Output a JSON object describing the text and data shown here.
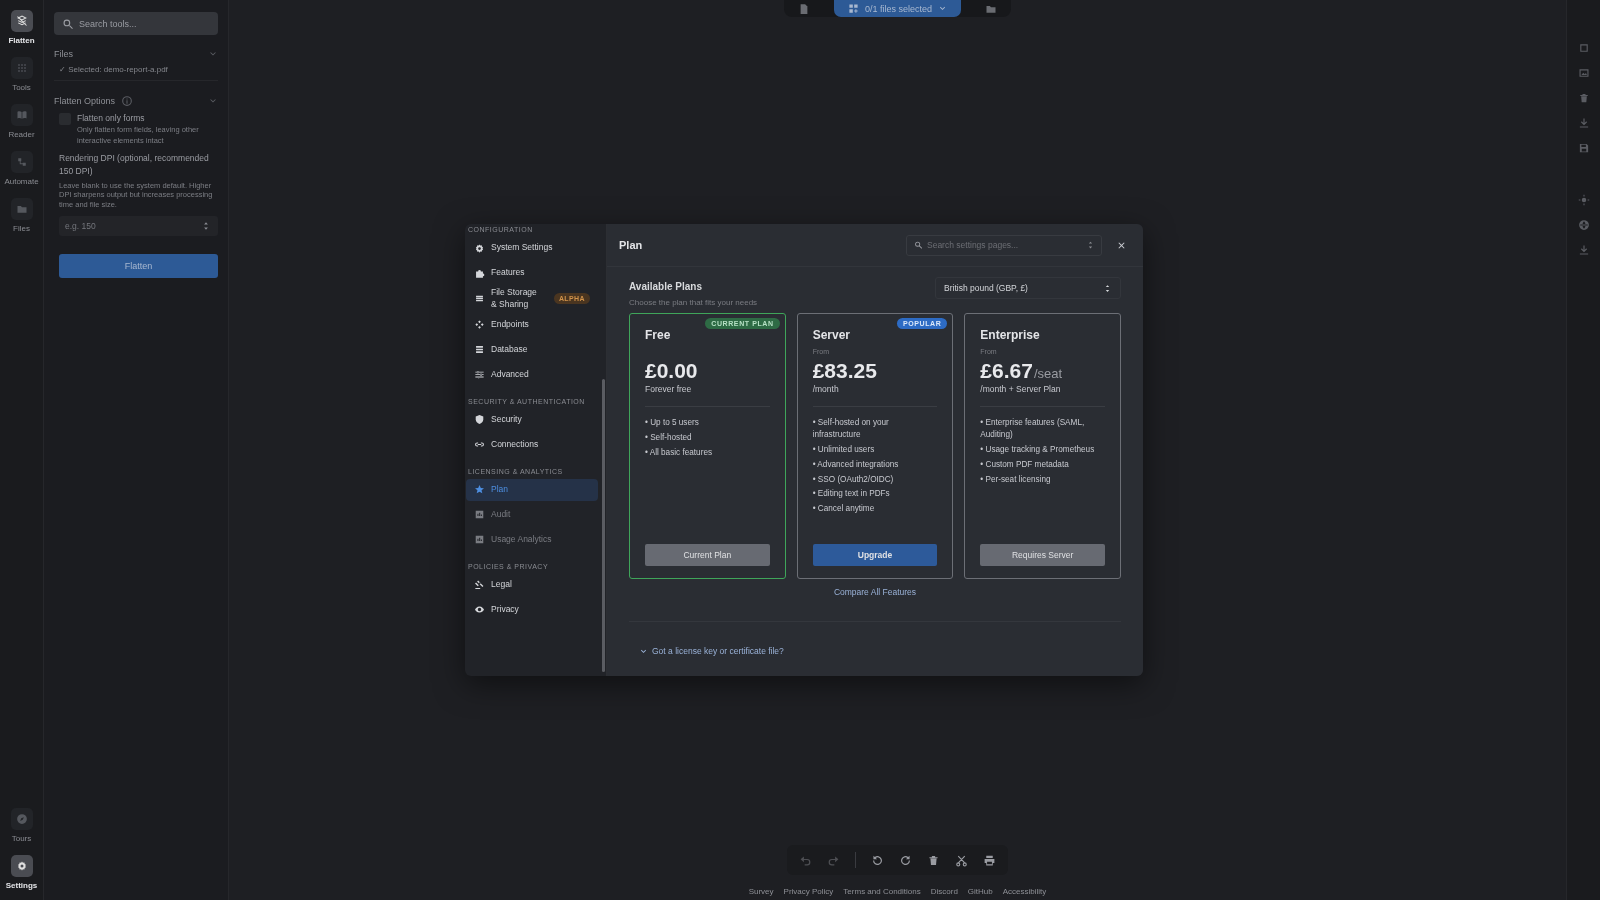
{
  "rail": {
    "items": [
      {
        "label": "Flatten",
        "selected": true
      },
      {
        "label": "Tools",
        "selected": false
      },
      {
        "label": "Reader",
        "selected": false
      },
      {
        "label": "Automate",
        "selected": false
      },
      {
        "label": "Files",
        "selected": false
      }
    ],
    "bottom_items": [
      {
        "label": "Tours",
        "selected": false
      },
      {
        "label": "Settings",
        "selected": true
      }
    ]
  },
  "tool_panel": {
    "search": {
      "placeholder": "Search tools..."
    },
    "files": {
      "title": "Files",
      "selected_file": "✓ Selected: demo-report-a.pdf"
    },
    "options": {
      "title": "Flatten Options",
      "checkbox": {
        "label": "Flatten only forms",
        "description": "Only flatten form fields, leaving other interactive elements intact",
        "checked": false
      },
      "dpi": {
        "label": "Rendering DPI (optional, recommended 150 DPI)",
        "help": "Leave blank to use the system default. Higher DPI sharpens output but increases processing time and file size.",
        "placeholder": "e.g. 150"
      }
    },
    "action_button": "Flatten"
  },
  "file_bar": {
    "label": "0/1 files selected"
  },
  "settings": {
    "sidebar": [
      {
        "heading": "CONFIGURATION",
        "items": [
          {
            "label": "System Settings",
            "selected": false,
            "disabled": false
          },
          {
            "label": "Features",
            "selected": false,
            "disabled": false
          },
          {
            "label": "File Storage & Sharing",
            "selected": false,
            "disabled": false,
            "badge": "ALPHA"
          },
          {
            "label": "Endpoints",
            "selected": false,
            "disabled": false
          },
          {
            "label": "Database",
            "selected": false,
            "disabled": false
          },
          {
            "label": "Advanced",
            "selected": false,
            "disabled": false
          }
        ]
      },
      {
        "heading": "SECURITY & AUTHENTICATION",
        "items": [
          {
            "label": "Security",
            "selected": false,
            "disabled": false
          },
          {
            "label": "Connections",
            "selected": false,
            "disabled": false
          }
        ]
      },
      {
        "heading": "LICENSING & ANALYTICS",
        "items": [
          {
            "label": "Plan",
            "selected": true,
            "disabled": false
          },
          {
            "label": "Audit",
            "selected": false,
            "disabled": true
          },
          {
            "label": "Usage Analytics",
            "selected": false,
            "disabled": true
          }
        ]
      },
      {
        "heading": "POLICIES & PRIVACY",
        "items": [
          {
            "label": "Legal",
            "selected": false,
            "disabled": false
          },
          {
            "label": "Privacy",
            "selected": false,
            "disabled": false
          }
        ]
      }
    ],
    "page_title": "Plan",
    "search": {
      "placeholder": "Search settings pages..."
    },
    "section_title": "Available Plans",
    "section_subtitle": "Choose the plan that fits your needs",
    "currency": {
      "value": "British pound (GBP, £)"
    },
    "plans": [
      {
        "name": "Free",
        "current": true,
        "badge": {
          "label": "CURRENT PLAN",
          "kind": "current"
        },
        "price": "£0.00",
        "period": "Forever free",
        "features": [
          "• Up to 5 users",
          "• Self-hosted",
          "• All basic features"
        ],
        "button": {
          "label": "Current Plan",
          "kind": "secondary"
        }
      },
      {
        "name": "Server",
        "current": false,
        "badge": {
          "label": "POPULAR",
          "kind": "popular"
        },
        "from": "From",
        "price": "£83.25",
        "period": "/month",
        "features": [
          "• Self-hosted on your infrastructure",
          "• Unlimited users",
          "• Advanced integrations",
          "• SSO (OAuth2/OIDC)",
          "• Editing text in PDFs",
          "• Cancel anytime"
        ],
        "button": {
          "label": "Upgrade",
          "kind": "primary"
        }
      },
      {
        "name": "Enterprise",
        "current": false,
        "from": "From",
        "price": "£6.67",
        "unit": "/seat",
        "period": "/month + Server Plan",
        "features": [
          "• Enterprise features (SAML, Auditing)",
          "• Usage tracking & Prometheus",
          "• Custom PDF metadata",
          "• Per-seat licensing"
        ],
        "button": {
          "label": "Requires Server",
          "kind": "secondary"
        }
      }
    ],
    "compare_link": "Compare All Features",
    "license_toggle": "Got a license key or certificate file?"
  },
  "footer_links": [
    "Survey",
    "Privacy Policy",
    "Terms and Conditions",
    "Discord",
    "GitHub",
    "Accessibility"
  ]
}
